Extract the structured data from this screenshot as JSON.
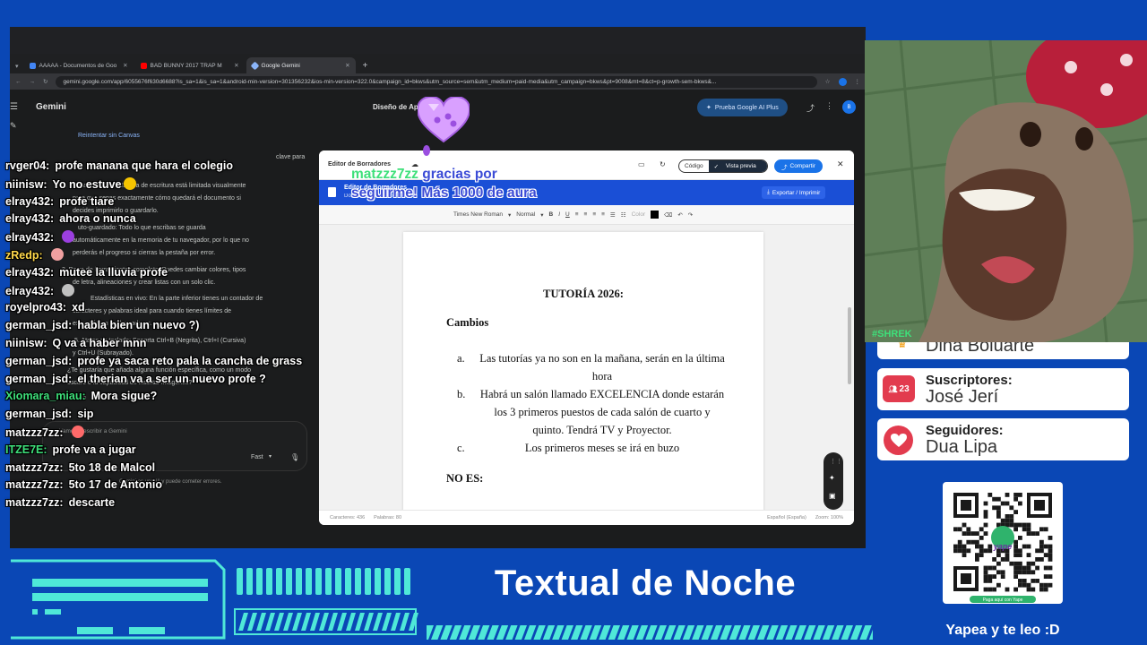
{
  "browser": {
    "tabs": [
      {
        "label": "AAAAA - Documentos de Goo",
        "color": "#4285f4"
      },
      {
        "label": "BAD BUNNY 2017 TRAP M",
        "color": "#ff0000"
      },
      {
        "label": "Google Gemini",
        "color": "#8ab4f8"
      }
    ],
    "new_tab": "+",
    "url": "gemini.google.com/app/6055676f630d6688?is_sa=1&is_sa=1&android-min-version=301356232&ios-min-version=322.0&campaign_id=bkws&utm_source=sem&utm_medium=paid-media&utm_campaign=bkws&pt=9008&mt=8&ct=p-growth-sem-bkws&..."
  },
  "gemini": {
    "app_title": "Gemini",
    "doc_title": "Diseño de Ap        ra Borradores",
    "plus_button": "Prueba Google AI Plus",
    "avatar": "B",
    "left_panel": {
      "retry_link": "Reintentar sin Canvas",
      "lines": [
        "clave para",
        "1.  Formato A4 Real: El área de escritura está limitada visualmente",
        "para que sepas exactamente cómo quedará el documento si",
        "decides imprimirlo o guardarlo.",
        "uto-guardado: Todo lo que escribas se guarda",
        "automáticamente en la memoria de tu navegador, por lo que no",
        "perderás el progreso si cierras la pestaña por error.",
        "3.  Barra de herramientas completa: Puedes cambiar colores, tipos",
        "de letra, alineaciones y crear listas con un solo clic.",
        "Estadísticas en vivo: En la parte inferior tienes un contador de",
        "caracteres y palabras ideal para cuando tienes límites de",
        "extensión en tus borradores.",
        "5.  Atajos de teclado: Soporta Ctrl+B (Negrita), Ctrl+I (Cursiva)",
        "y Ctrl+U (Subrayado).",
        "¿Te gustaría que añada alguna función específica, como un modo",
        "oscuro o la capacidad de insertar imágenes?"
      ],
      "input_placeholder": "Vamos a escribir a Gemini",
      "mode": "Fast",
      "disclaimer": "Gemini es una IA y puede cometer errores."
    }
  },
  "editor": {
    "header_label": "Editor de Borradores",
    "code_tab": "Código",
    "preview_tab": "Vista previa",
    "share_button": "Compartir",
    "close": "✕",
    "bar_title": "Editor de Borradores",
    "bar_subtitle": "Documento sin título",
    "export_button": "Exportar / Imprimir",
    "toolbar": {
      "font": "Times New Roman",
      "style": "Normal",
      "color_label": "Color"
    },
    "document": {
      "title": "TUTORÍA 2026:",
      "section": "Cambios",
      "items": [
        {
          "label": "a.",
          "text": "Las tutorías ya no son en la mañana, serán en la última hora"
        },
        {
          "label": "b.",
          "text": "Habrá un salón llamado EXCELENCIA donde estarán los 3 primeros puestos de cada salón de cuarto y quinto. Tendrá TV y Proyector."
        },
        {
          "label": "c.",
          "text": "Los primeros meses se irá en buzo"
        }
      ],
      "section2": "NO ES:"
    },
    "footer": {
      "chars": "Caracteres: 436",
      "words": "Palabras: 80",
      "lang": "Español (España)",
      "zoom": "Zoom: 100%"
    }
  },
  "chat": [
    {
      "user": "rvger04:",
      "text": "profe manana que hara el colegio",
      "color": "#ffffff"
    },
    {
      "user": "niinisw:",
      "text": "Yo no estuve",
      "color": "#ffffff",
      "emoji": "#f5c400"
    },
    {
      "user": "elray432:",
      "text": "profe tiare",
      "color": "#ffffff"
    },
    {
      "user": "elray432:",
      "text": "ahora o nunca",
      "color": "#ffffff"
    },
    {
      "user": "elray432:",
      "text": "",
      "color": "#ffffff",
      "emoji": "#9b3fe0"
    },
    {
      "user": "zRedp:",
      "text": "",
      "color": "#ffd84a",
      "emoji": "#f0a0a0"
    },
    {
      "user": "elray432:",
      "text": "mutee la lluvia profe",
      "color": "#ffffff"
    },
    {
      "user": "elray432:",
      "text": "",
      "color": "#ffffff",
      "emoji": "#c0c0c0"
    },
    {
      "user": "royelpro43:",
      "text": "xd",
      "color": "#ffffff"
    },
    {
      "user": "german_jsd:",
      "text": "habla bien un nuevo ?)",
      "color": "#ffffff"
    },
    {
      "user": "niinisw:",
      "text": "Q va a haber mnn",
      "color": "#ffffff"
    },
    {
      "user": "german_jsd:",
      "text": "profe ya saca reto pala la cancha de grass",
      "color": "#ffffff"
    },
    {
      "user": "german_jsd:",
      "text": "el therian va a ser un nuevo profe ?",
      "color": "#ffffff"
    },
    {
      "user": "Xiomara_miau:",
      "text": "Mora sigue?",
      "color": "#3ee07a"
    },
    {
      "user": "german_jsd:",
      "text": "sip",
      "color": "#ffffff"
    },
    {
      "user": "matzzz7zz:",
      "text": "",
      "color": "#ffffff",
      "emoji": "#ff6a6a"
    },
    {
      "user": "ITZE7E:",
      "text": "profe va a jugar",
      "color": "#3ee07a"
    },
    {
      "user": "matzzz7zz:",
      "text": "5to 18 de Malcol",
      "color": "#ffffff"
    },
    {
      "user": "matzzz7zz:",
      "text": "5to 17 de Antonio",
      "color": "#ffffff"
    },
    {
      "user": "matzzz7zz:",
      "text": "descarte",
      "color": "#ffffff"
    }
  ],
  "alert": {
    "user": "matzzz7zz",
    "text": " gracias por seguirme! Más 1000 de aura"
  },
  "stats": {
    "top_partial": "Dina Boluarte",
    "subscribers_label": "Suscriptores:",
    "subscribers_count": "23",
    "subscribers_name": "José Jerí",
    "followers_label": "Seguidores:",
    "followers_name": "Dua Lipa"
  },
  "cam_tag": "#SHREK",
  "qr": {
    "brand": "yape",
    "caption": "Paga aquí con Yape",
    "label": "Yapea y te leo :D"
  },
  "banner": "Textual de Noche",
  "colors": {
    "background": "#0a47b5",
    "accent_cyan": "#4fe8d8",
    "chat_green": "#3ee07a",
    "editor_blue": "#1a4fd6"
  }
}
